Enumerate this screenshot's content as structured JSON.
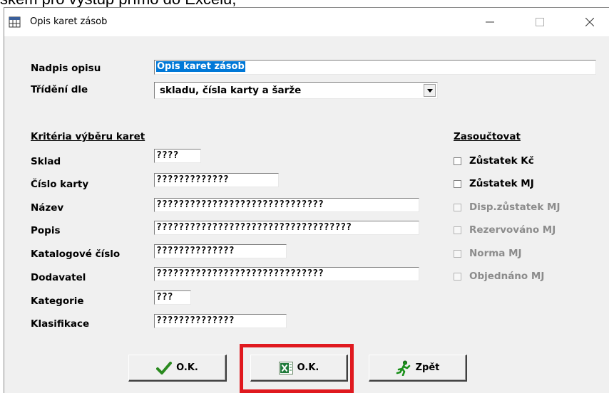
{
  "background_caption": "skem pro výstup přímo do Excelu,",
  "window": {
    "title": "Opis karet zásob",
    "icon": "table-grid-icon"
  },
  "header": {
    "caption_label": "Nadpis opisu",
    "caption_value": "Opis karet zásob",
    "sort_label": "Třídění dle",
    "sort_value": "skladu, čísla karty a šarže"
  },
  "criteria": {
    "heading": "Kritéria výběru karet",
    "fields": [
      {
        "label": "Sklad",
        "value": "????"
      },
      {
        "label": "Číslo karty",
        "value": "?????????????"
      },
      {
        "label": "Název",
        "value": "??????????????????????????????"
      },
      {
        "label": "Popis",
        "value": "???????????????????????????????????"
      },
      {
        "label": "Katalogové číslo",
        "value": "??????????????"
      },
      {
        "label": "Dodavatel",
        "value": "??????????????????????????????"
      },
      {
        "label": "Kategorie",
        "value": "???"
      },
      {
        "label": "Klasifikace",
        "value": "??????????????"
      }
    ]
  },
  "totals": {
    "heading": "Zasoučtovat",
    "items": [
      {
        "label": "Zůstatek Kč",
        "enabled": true,
        "checked": false
      },
      {
        "label": "Zůstatek MJ",
        "enabled": true,
        "checked": false
      },
      {
        "label": "Disp.zůstatek MJ",
        "enabled": false,
        "checked": false
      },
      {
        "label": "Rezervováno MJ",
        "enabled": false,
        "checked": false
      },
      {
        "label": "Norma MJ",
        "enabled": false,
        "checked": false
      },
      {
        "label": "Objednáno MJ",
        "enabled": false,
        "checked": false
      }
    ]
  },
  "buttons": {
    "ok_label": "O.K.",
    "excel_ok_label": "O.K.",
    "back_label": "Zpět"
  },
  "colors": {
    "selection_bg": "#0078d7",
    "disabled_text": "#8c8c8c",
    "highlight_frame": "#e0191f",
    "check_green": "#2a8a1f",
    "excel_green": "#1f7a3a"
  }
}
